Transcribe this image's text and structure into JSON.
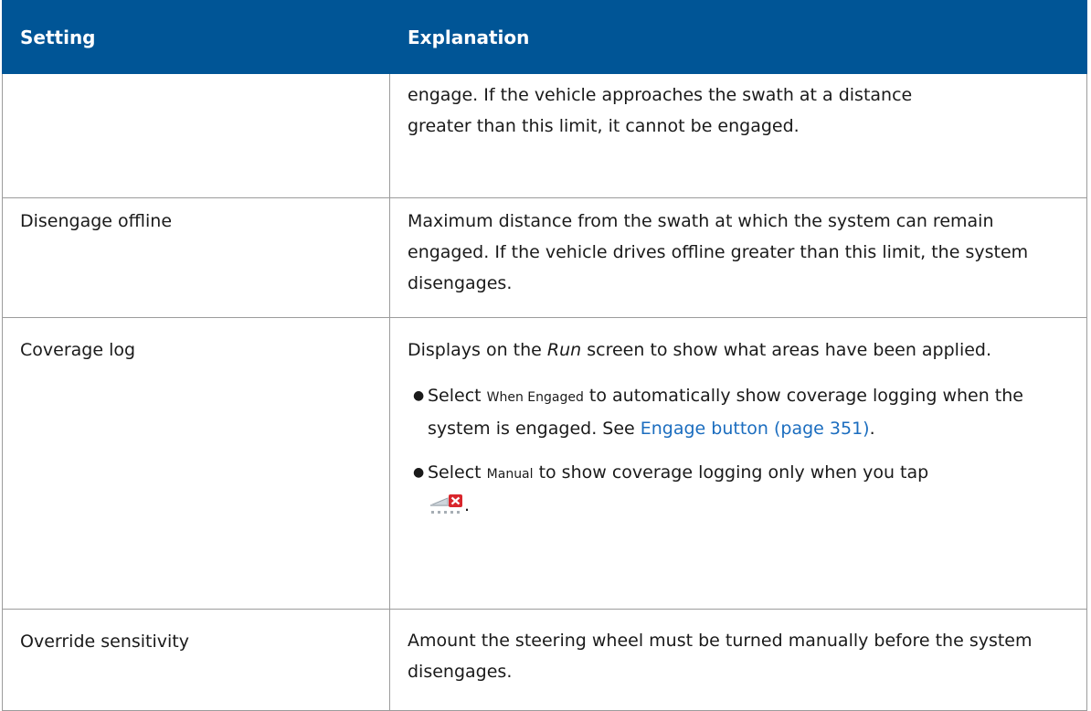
{
  "table": {
    "headers": [
      "Setting",
      "Explanation"
    ],
    "row1": {
      "setting": "",
      "line1": "engage. If the vehicle approaches the swath at a distance",
      "line2": "greater than this limit, it cannot be engaged."
    },
    "row2": {
      "setting": "Disengage offline",
      "explanation": "Maximum distance from the swath at which the system can remain engaged. If the vehicle drives offline greater than this limit, the system disengages."
    },
    "row3": {
      "setting": "Coverage log",
      "intro_before": "Displays on the ",
      "intro_italic": "Run",
      "intro_after": " screen to show what areas have been applied.",
      "bullet1_pre": "Select ",
      "bullet1_option": "When Engaged",
      "bullet1_post": " to automatically show coverage logging when the system is engaged. See ",
      "bullet1_link": "Engage button (page 351)",
      "bullet1_end": ".",
      "bullet2_pre": "Select ",
      "bullet2_option": "Manual",
      "bullet2_post": " to show coverage logging only when you tap",
      "bullet2_end": "."
    },
    "row4": {
      "setting": "Override sensitivity",
      "explanation": "Amount the steering wheel must be turned manually before the system disengages."
    }
  },
  "colors": {
    "header_bg": "#005596",
    "link": "#1b6dbf",
    "border": "#9c9c9c"
  },
  "icons": {
    "coverage_log_icon": "coverage-log-disabled-icon"
  }
}
